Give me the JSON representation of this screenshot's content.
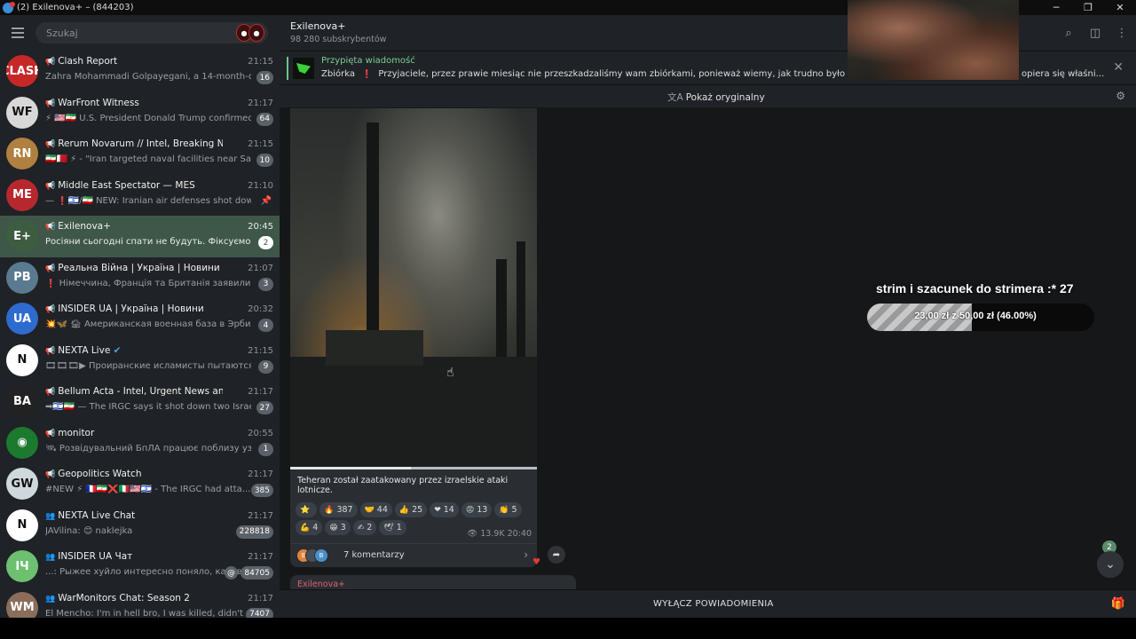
{
  "window": {
    "title": "(2) Exilenova+ – (844203)",
    "controls": [
      "─",
      "❐",
      "✕"
    ]
  },
  "sidebar": {
    "search_placeholder": "Szukaj",
    "chats": [
      {
        "name": "Clash Report",
        "time": "21:15",
        "preview": "Zahra Mohammadi Golpayegani, a 14-month-ol...",
        "badge": "16",
        "avatar_color": "#c62828",
        "avatar_text": "CLASH"
      },
      {
        "name": "WarFront Witness",
        "time": "21:17",
        "preview": "⚡ 🇺🇸🇮🇷 U.S. President Donald Trump confirmed ...",
        "badge": "64",
        "avatar_color": "#d8d8d8",
        "avatar_text": "WF"
      },
      {
        "name": "Rerum Novarum // Intel, Breaking News, and ...",
        "time": "21:15",
        "preview": "🇮🇷🇧🇭 ⚡ - \"Iran targeted naval facilities near Salm...",
        "badge": "10",
        "avatar_color": "#b08040",
        "avatar_text": "RN"
      },
      {
        "name": "Middle East Spectator — MES",
        "time": "21:10",
        "preview": "— ❗🇮🇱/🇮🇷 NEW: Iranian air defenses shot down ...",
        "badge": "",
        "pinned": true,
        "avatar_color": "#b7282e",
        "avatar_text": "ME"
      },
      {
        "name": "Exilenova+",
        "time": "20:45",
        "preview": "Росіяни сьогодні спати не будуть. Фіксуємо макси...",
        "badge": "2",
        "active": true,
        "avatar_color": "#3d5d40",
        "avatar_text": "E+"
      },
      {
        "name": "Реальна Війна | Україна | Новини",
        "time": "21:07",
        "preview": "❗ Німеччина, Франція та Британія заявили Іран...",
        "badge": "3",
        "avatar_color": "#5a7a90",
        "avatar_text": "РВ"
      },
      {
        "name": "INSIDER UA | Україна | Новини",
        "time": "20:32",
        "preview": "💥🦋 🏚 Американская военная база в Эрбиле, ...",
        "badge": "4",
        "avatar_color": "#2e6bd0",
        "avatar_text": "UA"
      },
      {
        "name": "NEXTA Live",
        "time": "21:15",
        "preview": "🎞🎞🎞▶ Проиранские исламисты пытаются взят...",
        "badge": "9",
        "verified": true,
        "avatar_color": "#ffffff",
        "avatar_text": "N"
      },
      {
        "name": "Bellum Acta - Intel, Urgent News and Archive...",
        "time": "21:17",
        "preview": "➡🇮🇱🇮🇷 — The IRGC says it shot down two Israeli...",
        "badge": "27",
        "avatar_color": "#222222",
        "avatar_text": "BA"
      },
      {
        "name": "monitor",
        "time": "20:55",
        "preview": "🛰 Розвідувальний БпЛА працює поблизу узбере...",
        "badge": "1",
        "avatar_color": "#1b7a2e",
        "avatar_text": "◉"
      },
      {
        "name": "Geopolitics Watch",
        "time": "21:17",
        "preview": "#NEW ⚡ 🇫🇷🇮🇷❌🇮🇹🇺🇸🇮🇱 - The IRGC had atta...",
        "badge": "385",
        "avatar_color": "#cfd8dc",
        "avatar_text": "GW"
      },
      {
        "name": "NEXTA Live Chat",
        "time": "21:17",
        "preview": "JAVilina: 😊 naklejka",
        "badge": "228818",
        "group": true,
        "avatar_color": "#ffffff",
        "avatar_text": "N"
      },
      {
        "name": "INSIDER UA Чат",
        "time": "21:17",
        "preview": "...: Рыжее хуйло интересно поняло, каков...",
        "badge": "84705",
        "group": true,
        "mention": true,
        "avatar_color": "#6cc070",
        "avatar_text": "IЧ"
      },
      {
        "name": "WarMonitors Chat: Season 2",
        "time": "21:17",
        "preview": "El Mencho: I'm in hell bro, I was killed, didn't u h...",
        "badge": "7407",
        "group": true,
        "avatar_color": "#8a6d5a",
        "avatar_text": "WM"
      }
    ]
  },
  "header": {
    "title": "Exilenova+",
    "subtitle": "98 280 subskrybentów"
  },
  "pinned": {
    "label": "Przypięta wiadomość",
    "prefix": "Zbiórka",
    "text": "Przyjaciele, przez prawie miesiąc nie przeszkadzaliśmy wam zbiórkami, ponieważ wiemy, jak trudno było wam przetrwać",
    "tail": "opiera się właśni..."
  },
  "translate": {
    "label": "Pokaż oryginalny"
  },
  "message": {
    "caption": "Teheran został zaatakowany przez izraelskie ataki lotnicze.",
    "video_progress": 0.49,
    "reactions": [
      {
        "emoji": "⭐",
        "count": ""
      },
      {
        "emoji": "🔥",
        "count": "387"
      },
      {
        "emoji": "🤝",
        "count": "44"
      },
      {
        "emoji": "👍",
        "count": "25"
      },
      {
        "emoji": "❤",
        "count": "14"
      },
      {
        "emoji": "😡",
        "count": "13"
      },
      {
        "emoji": "👏",
        "count": "5"
      },
      {
        "emoji": "💪",
        "count": "4"
      },
      {
        "emoji": "😁",
        "count": "3"
      },
      {
        "emoji": "✍",
        "count": "2"
      },
      {
        "emoji": "🕊",
        "count": "1"
      }
    ],
    "views": "13.9K",
    "time": "20:40",
    "comments_label": "7 komentarzy"
  },
  "next_message_author": "Exilenova+",
  "footer": {
    "mute_label": "WYŁĄCZ POWIADOMIENIA"
  },
  "scroll_count": "2",
  "overlay": {
    "title": "strim i szacunek do strimera :*",
    "title_count": "27",
    "goal_text": "23,00 zł z 50,00 zł (46.00%)",
    "goal_fraction": 0.46
  }
}
